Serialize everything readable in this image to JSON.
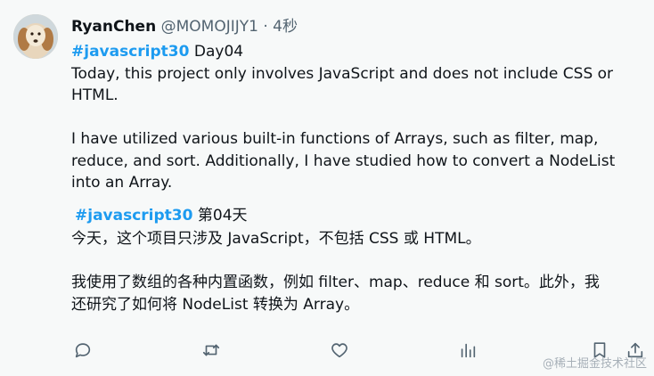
{
  "author": {
    "name": "RyanChen",
    "handle": "@MOMOJIJY1",
    "separator": "·",
    "time": "4秒"
  },
  "english": {
    "hashtag": "#javascript30",
    "hashtag_suffix": " Day04",
    "lines": [
      "Today, this project only involves JavaScript and does not include CSS or",
      "HTML.",
      "",
      "I have utilized various built-in functions of Arrays, such as filter, map,",
      "reduce, and sort. Additionally, I have studied how to convert a NodeList",
      "into an Array."
    ]
  },
  "chinese": {
    "hashtag": "#javascript30",
    "hashtag_suffix": " 第04天",
    "lines": [
      "今天，这个项目只涉及 JavaScript，不包括 CSS 或 HTML。",
      "",
      "我使用了数组的各种内置函数，例如 filter、map、reduce 和 sort。此外，我",
      "还研究了如何将 NodeList 转换为 Array。"
    ]
  },
  "actions": {
    "reply_icon": "reply-icon",
    "retweet_icon": "retweet-icon",
    "like_icon": "heart-icon",
    "views_icon": "views-icon",
    "bookmark_icon": "bookmark-icon",
    "share_icon": "share-icon"
  },
  "watermark": "@稀土掘金技术社区",
  "colors": {
    "background": "#f7f9f9",
    "text": "#0f1419",
    "secondary": "#536471",
    "hashtag": "#1d9bf0"
  }
}
